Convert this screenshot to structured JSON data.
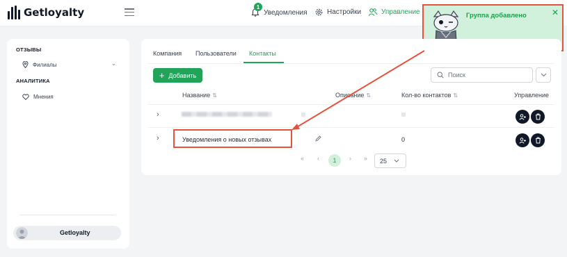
{
  "app": {
    "name": "Getloyalty"
  },
  "topbar": {
    "notifications_label": "Уведомления",
    "notifications_count": "1",
    "settings_label": "Настройки",
    "manage_label": "Управление"
  },
  "toast": {
    "message": "Группа добавлено",
    "close": "✕"
  },
  "sidebar": {
    "section_reviews": "ОТЗЫВЫ",
    "branches_label": "Филиалы",
    "section_analytics": "АНАЛИТИКА",
    "opinions_label": "Мнения",
    "user_name": "Getloyalty"
  },
  "tabs": [
    {
      "label": "Компания"
    },
    {
      "label": "Пользователи"
    },
    {
      "label": "Контакты",
      "active": true
    }
  ],
  "toolbar": {
    "add_label": "Добавить",
    "search_placeholder": "Поиск"
  },
  "table": {
    "headers": {
      "name": "Название",
      "description": "Описание",
      "contacts_count": "Кол-во контактов",
      "manage": "Управление"
    },
    "rows": [
      {
        "name": "",
        "description": "",
        "contacts_count": ""
      },
      {
        "name": "Уведомления о новых отзывах",
        "description": "",
        "contacts_count": "0"
      }
    ]
  },
  "pagination": {
    "first": "«",
    "prev": "‹",
    "current_page": "1",
    "next": "›",
    "last": "»",
    "per_page": "25"
  },
  "colors": {
    "accent": "#22a35a",
    "annotation": "#e5533d",
    "toast_bg": "#d1f1dc"
  }
}
